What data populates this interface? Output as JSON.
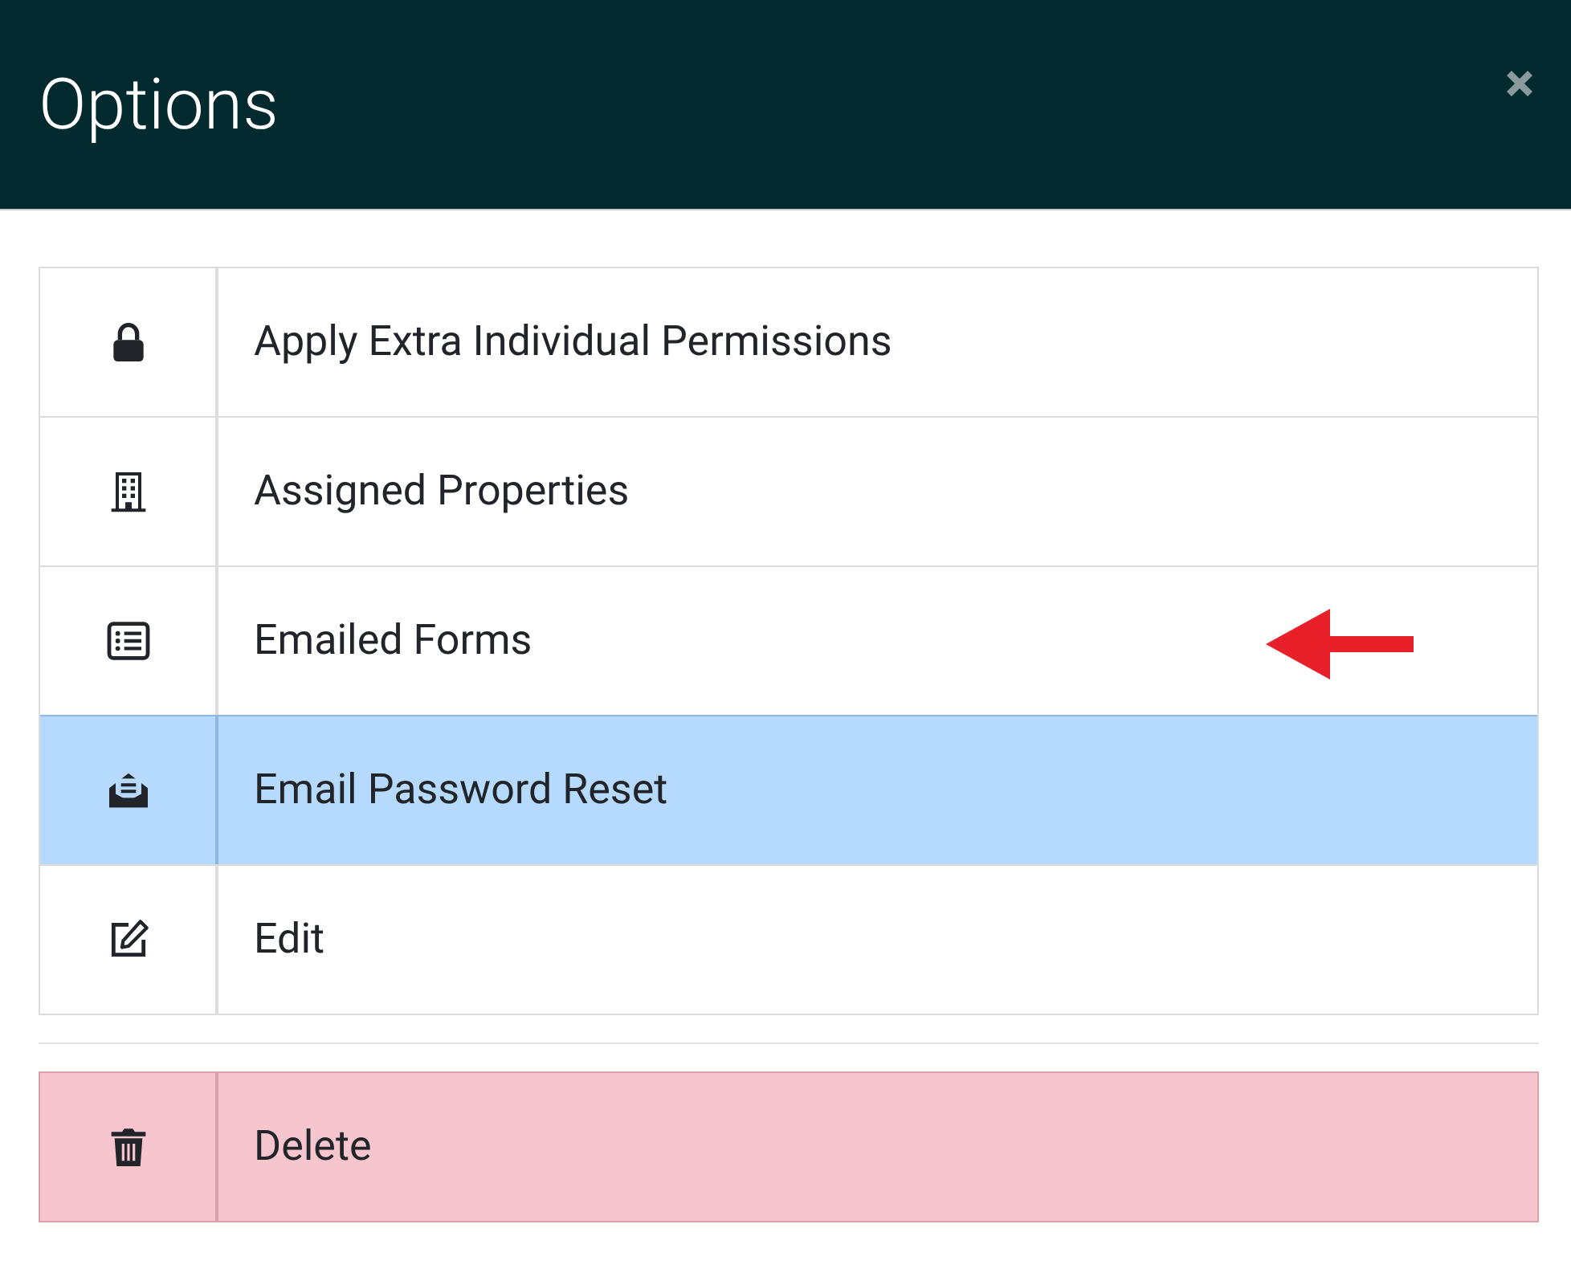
{
  "header": {
    "title": "Options"
  },
  "options": [
    {
      "label": "Apply Extra Individual Permissions",
      "selected": false
    },
    {
      "label": "Assigned Properties",
      "selected": false
    },
    {
      "label": "Emailed Forms",
      "selected": false
    },
    {
      "label": "Email Password Reset",
      "selected": true
    },
    {
      "label": "Edit",
      "selected": false
    }
  ],
  "danger_options": [
    {
      "label": "Delete",
      "selected": false
    }
  ]
}
